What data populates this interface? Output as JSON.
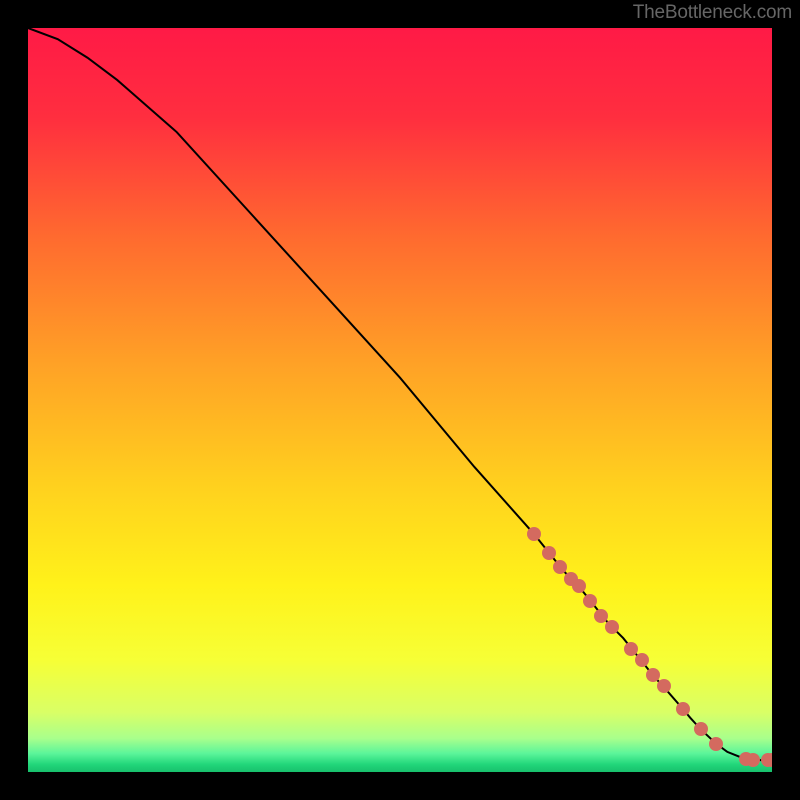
{
  "watermark": "TheBottleneck.com",
  "chart_data": {
    "type": "line",
    "title": "",
    "xlabel": "",
    "ylabel": "",
    "xlim": [
      0,
      100
    ],
    "ylim": [
      0,
      100
    ],
    "series": [
      {
        "name": "curve",
        "x": [
          0,
          4,
          8,
          12,
          20,
          30,
          40,
          50,
          60,
          68,
          70,
          72,
          74,
          76,
          78,
          80,
          82,
          84,
          86,
          88,
          89,
          90,
          91,
          92.5,
          94,
          96.5,
          97.5,
          99.5,
          100
        ],
        "y": [
          100,
          98.5,
          96,
          93,
          86,
          75,
          64,
          53,
          41,
          32,
          29.5,
          27,
          25,
          22.5,
          20,
          18,
          15.5,
          13,
          10.8,
          8.5,
          7.3,
          6.2,
          5.2,
          3.8,
          2.7,
          1.7,
          1.6,
          1.6,
          1.6
        ]
      }
    ],
    "points": {
      "name": "dots",
      "x": [
        68,
        70,
        71.5,
        73,
        74,
        75.5,
        77,
        78.5,
        81,
        82.5,
        84,
        85.5,
        88,
        90.5,
        92.5,
        96.5,
        97.5,
        99.5,
        100
      ],
      "y": [
        32,
        29.5,
        27.5,
        26,
        25,
        23,
        21,
        19.5,
        16.5,
        15,
        13,
        11.5,
        8.5,
        5.8,
        3.8,
        1.7,
        1.6,
        1.6,
        1.6
      ]
    },
    "gradient_stops": [
      {
        "pos": 0.0,
        "color": "#ff1a46"
      },
      {
        "pos": 0.12,
        "color": "#ff2e3f"
      },
      {
        "pos": 0.28,
        "color": "#ff6a2f"
      },
      {
        "pos": 0.45,
        "color": "#ffa126"
      },
      {
        "pos": 0.62,
        "color": "#ffd21e"
      },
      {
        "pos": 0.75,
        "color": "#fff21a"
      },
      {
        "pos": 0.85,
        "color": "#f6ff36"
      },
      {
        "pos": 0.92,
        "color": "#d9ff66"
      },
      {
        "pos": 0.955,
        "color": "#a8ff8c"
      },
      {
        "pos": 0.975,
        "color": "#5cf59a"
      },
      {
        "pos": 0.99,
        "color": "#21d67a"
      },
      {
        "pos": 1.0,
        "color": "#18c06c"
      }
    ]
  }
}
